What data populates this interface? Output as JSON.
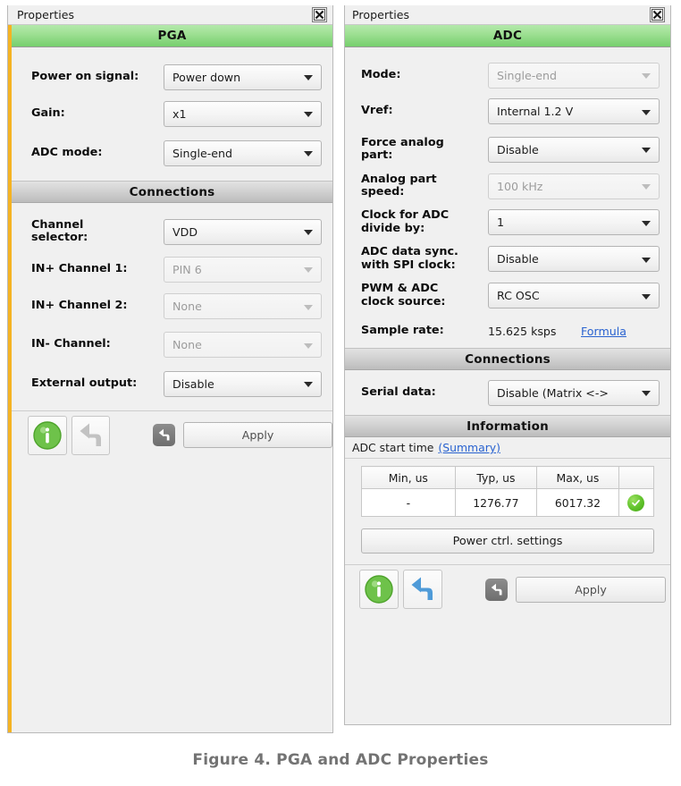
{
  "caption": "Figure 4. PGA and ADC Properties",
  "colors": {
    "accent_strip": "#f5b323",
    "header_green": "#76cf6d",
    "header_gray": "#bcbcbc",
    "link_blue": "#2a63d0",
    "ok_green": "#5fc12a",
    "caption_gray": "#737373"
  },
  "pga_panel": {
    "titlebar": {
      "title": "Properties",
      "close_icon": "close-icon"
    },
    "header": "PGA",
    "fields": [
      {
        "label": "Power on signal:",
        "value": "Power down",
        "disabled": false
      },
      {
        "label": "Gain:",
        "value": "x1",
        "disabled": false
      },
      {
        "label": "ADC mode:",
        "value": "Single-end",
        "disabled": false
      }
    ],
    "connections_header": "Connections",
    "connections": [
      {
        "label": "Channel selector:",
        "value": "VDD",
        "disabled": false
      },
      {
        "label": "IN+ Channel 1:",
        "value": "PIN 6",
        "disabled": true
      },
      {
        "label": "IN+ Channel 2:",
        "value": "None",
        "disabled": true
      },
      {
        "label": "IN- Channel:",
        "value": "None",
        "disabled": true
      },
      {
        "label": "External output:",
        "value": "Disable",
        "disabled": false
      }
    ],
    "buttons": {
      "info_icon": "info-icon",
      "undo_icon": "undo-arrow-icon",
      "undo_enabled": false,
      "reset_icon": "reset-icon",
      "apply_label": "Apply"
    }
  },
  "adc_panel": {
    "titlebar": {
      "title": "Properties",
      "close_icon": "close-icon"
    },
    "header": "ADC",
    "fields": [
      {
        "label": "Mode:",
        "value": "Single-end",
        "disabled": true
      },
      {
        "label": "Vref:",
        "value": "Internal 1.2 V",
        "disabled": false
      },
      {
        "label": "Force analog part:",
        "value": "Disable",
        "disabled": false
      },
      {
        "label": "Analog part speed:",
        "value": "100 kHz",
        "disabled": true
      },
      {
        "label": "Clock for ADC divide by:",
        "value": "1",
        "disabled": false
      },
      {
        "label": "ADC data sync. with SPI clock:",
        "value": "Disable",
        "disabled": false
      },
      {
        "label": "PWM & ADC clock source:",
        "value": "RC OSC",
        "disabled": false
      }
    ],
    "sample_rate": {
      "label": "Sample rate:",
      "value": "15.625 ksps",
      "link": "Formula"
    },
    "connections_header": "Connections",
    "connections": [
      {
        "label": "Serial data:",
        "value": "Disable (Matrix <->",
        "disabled": false
      }
    ],
    "information_header": "Information",
    "info_line": {
      "text": "ADC start time",
      "link": "(Summary)"
    },
    "info_table": {
      "columns": [
        "Min, us",
        "Typ, us",
        "Max, us",
        ""
      ],
      "rows": [
        [
          "-",
          "1276.77",
          "6017.32",
          "ok-check-icon"
        ]
      ]
    },
    "power_button": "Power ctrl. settings",
    "buttons": {
      "info_icon": "info-icon",
      "undo_icon": "undo-arrow-icon",
      "undo_enabled": true,
      "reset_icon": "reset-icon",
      "apply_label": "Apply"
    }
  }
}
